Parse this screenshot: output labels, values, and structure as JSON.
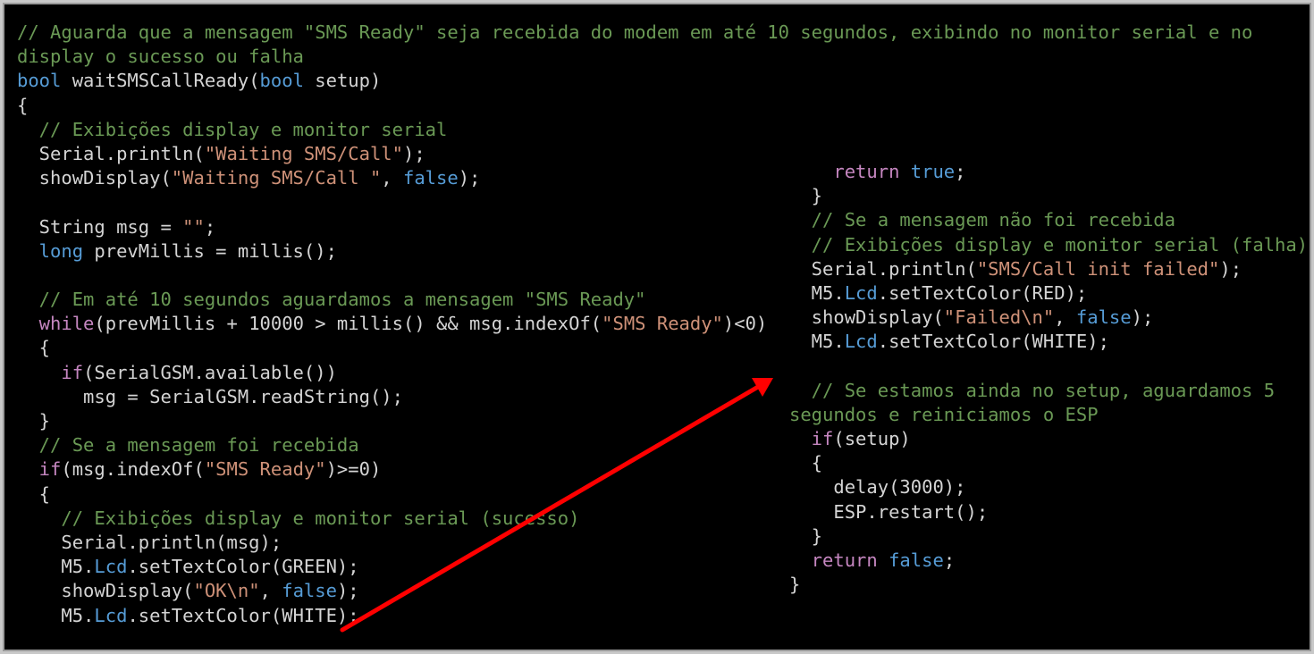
{
  "annotation": {
    "arrow_color": "#ff0000"
  },
  "colors": {
    "background": "#000000",
    "comment": "#6a9955",
    "keyword": "#569cd6",
    "control": "#c586c0",
    "string": "#ce9178",
    "plain": "#d4d4d4"
  },
  "left_code": [
    [
      [
        "comment",
        "// Aguarda que a mensagem \"SMS Ready\" seja recebida do modem em até 10 segundos, exibindo no monitor serial e no"
      ]
    ],
    [
      [
        "comment",
        "display o sucesso ou falha"
      ]
    ],
    [
      [
        "keyword",
        "bool"
      ],
      [
        "plain",
        " waitSMSCallReady("
      ],
      [
        "keyword",
        "bool"
      ],
      [
        "plain",
        " setup)"
      ]
    ],
    [
      [
        "plain",
        "{"
      ]
    ],
    [
      [
        "comment",
        "  // Exibições display e monitor serial"
      ]
    ],
    [
      [
        "plain",
        "  Serial.println("
      ],
      [
        "string",
        "\"Waiting SMS/Call\""
      ],
      [
        "plain",
        ");"
      ]
    ],
    [
      [
        "plain",
        "  showDisplay("
      ],
      [
        "string",
        "\"Waiting SMS/Call \""
      ],
      [
        "plain",
        ", "
      ],
      [
        "keyword",
        "false"
      ],
      [
        "plain",
        ");"
      ]
    ],
    [
      [
        "plain",
        ""
      ]
    ],
    [
      [
        "plain",
        "  String msg = "
      ],
      [
        "string",
        "\"\""
      ],
      [
        "plain",
        ";"
      ]
    ],
    [
      [
        "keyword",
        "  long"
      ],
      [
        "plain",
        " prevMillis = millis();"
      ]
    ],
    [
      [
        "plain",
        ""
      ]
    ],
    [
      [
        "comment",
        "  // Em até 10 segundos aguardamos a mensagem \"SMS Ready\""
      ]
    ],
    [
      [
        "control",
        "  while"
      ],
      [
        "plain",
        "(prevMillis + 10000 > millis() && msg.indexOf("
      ],
      [
        "string",
        "\"SMS Ready\""
      ],
      [
        "plain",
        ")<0)"
      ]
    ],
    [
      [
        "plain",
        "  {"
      ]
    ],
    [
      [
        "control",
        "    if"
      ],
      [
        "plain",
        "(SerialGSM.available())"
      ]
    ],
    [
      [
        "plain",
        "      msg = SerialGSM.readString();"
      ]
    ],
    [
      [
        "plain",
        "  }"
      ]
    ],
    [
      [
        "comment",
        "  // Se a mensagem foi recebida"
      ]
    ],
    [
      [
        "control",
        "  if"
      ],
      [
        "plain",
        "(msg.indexOf("
      ],
      [
        "string",
        "\"SMS Ready\""
      ],
      [
        "plain",
        ")>=0)"
      ]
    ],
    [
      [
        "plain",
        "  {"
      ]
    ],
    [
      [
        "comment",
        "    // Exibições display e monitor serial (sucesso)"
      ]
    ],
    [
      [
        "plain",
        "    Serial.println(msg);"
      ]
    ],
    [
      [
        "plain",
        "    M5."
      ],
      [
        "keyword",
        "Lcd"
      ],
      [
        "plain",
        ".setTextColor(GREEN);"
      ]
    ],
    [
      [
        "plain",
        "    showDisplay("
      ],
      [
        "string",
        "\"OK\\n\""
      ],
      [
        "plain",
        ", "
      ],
      [
        "keyword",
        "false"
      ],
      [
        "plain",
        ");"
      ]
    ],
    [
      [
        "plain",
        "    M5."
      ],
      [
        "keyword",
        "Lcd"
      ],
      [
        "plain",
        ".setTextColor(WHITE);"
      ]
    ]
  ],
  "right_code": [
    [
      [
        "control",
        "    return"
      ],
      [
        "plain",
        " "
      ],
      [
        "keyword",
        "true"
      ],
      [
        "plain",
        ";"
      ]
    ],
    [
      [
        "plain",
        "  }"
      ]
    ],
    [
      [
        "comment",
        "  // Se a mensagem não foi recebida"
      ]
    ],
    [
      [
        "comment",
        "  // Exibições display e monitor serial (falha)"
      ]
    ],
    [
      [
        "plain",
        "  Serial.println("
      ],
      [
        "string",
        "\"SMS/Call init failed\""
      ],
      [
        "plain",
        ");"
      ]
    ],
    [
      [
        "plain",
        "  M5."
      ],
      [
        "keyword",
        "Lcd"
      ],
      [
        "plain",
        ".setTextColor(RED);"
      ]
    ],
    [
      [
        "plain",
        "  showDisplay("
      ],
      [
        "string",
        "\"Failed\\n\""
      ],
      [
        "plain",
        ", "
      ],
      [
        "keyword",
        "false"
      ],
      [
        "plain",
        ");"
      ]
    ],
    [
      [
        "plain",
        "  M5."
      ],
      [
        "keyword",
        "Lcd"
      ],
      [
        "plain",
        ".setTextColor(WHITE);"
      ]
    ],
    [
      [
        "plain",
        ""
      ]
    ],
    [
      [
        "comment",
        "  // Se estamos ainda no setup, aguardamos 5"
      ]
    ],
    [
      [
        "comment",
        "segundos e reiniciamos o ESP"
      ]
    ],
    [
      [
        "control",
        "  if"
      ],
      [
        "plain",
        "(setup)"
      ]
    ],
    [
      [
        "plain",
        "  {"
      ]
    ],
    [
      [
        "plain",
        "    delay(3000);"
      ]
    ],
    [
      [
        "plain",
        "    ESP.restart();"
      ]
    ],
    [
      [
        "plain",
        "  }"
      ]
    ],
    [
      [
        "control",
        "  return"
      ],
      [
        "plain",
        " "
      ],
      [
        "keyword",
        "false"
      ],
      [
        "plain",
        ";"
      ]
    ],
    [
      [
        "plain",
        "}"
      ]
    ]
  ]
}
